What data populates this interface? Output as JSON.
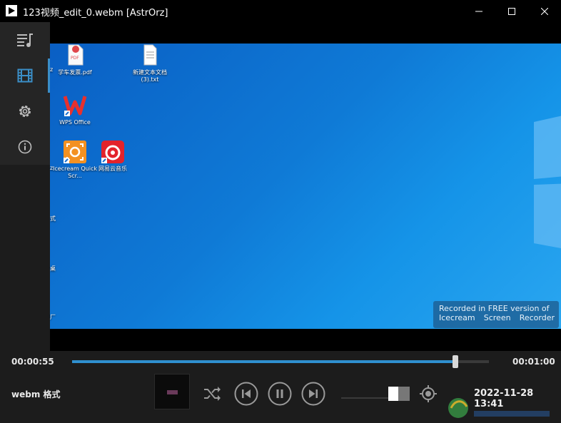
{
  "window": {
    "title": "123视频_edit_0.webm [AstrOrz]",
    "min_icon": "minimize-icon",
    "max_icon": "maximize-icon",
    "close_icon": "close-icon"
  },
  "sidebar": {
    "items": [
      {
        "icon": "playlist-icon",
        "active": false
      },
      {
        "icon": "film-icon",
        "active": true
      },
      {
        "icon": "gear-icon",
        "active": false
      },
      {
        "icon": "info-icon",
        "active": false
      }
    ],
    "accent": "#3a8ec7"
  },
  "video": {
    "desktop_icons": [
      {
        "label": "学车发票.pdf",
        "icon": "pdf-icon"
      },
      {
        "label": "新建文本文档 (3).txt",
        "icon": "text-file-icon"
      },
      {
        "label": "WPS Office",
        "icon": "wps-icon"
      },
      {
        "label": "Icecream Quick Scr...",
        "icon": "icecream-icon"
      },
      {
        "label": "网易云音乐",
        "icon": "netease-music-icon"
      }
    ],
    "edge_labels": [
      "z",
      "式",
      "桌",
      "厂"
    ],
    "watermark_line1": "Recorded in FREE version of",
    "watermark_line2_a": "Icecream",
    "watermark_line2_b": "Screen",
    "watermark_line2_c": "Recorder"
  },
  "controls": {
    "current_time": "00:00:55",
    "total_time": "00:01:00",
    "progress": 0.92,
    "format_label": "webm 格式",
    "volume": 0.7,
    "timestamp": "2022-11-28 13:41",
    "accent": "#2f8fcf",
    "icons": [
      "shuffle-icon",
      "skip-previous-icon",
      "pause-icon",
      "skip-next-icon",
      "target-icon"
    ]
  }
}
